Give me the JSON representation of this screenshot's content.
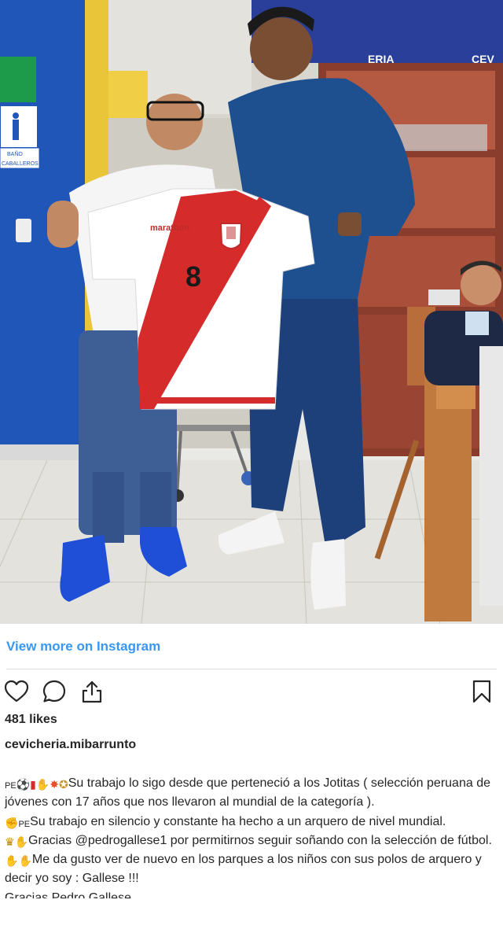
{
  "photo": {
    "store_sign_left": "BAÑO",
    "store_sign_right": "CABALLEROS",
    "wall_text_1": "ERIA",
    "wall_text_2": "CEV",
    "jersey_sponsor": "marathon",
    "jersey_number": "8"
  },
  "view_more": "View more on Instagram",
  "likes": "481 likes",
  "username": "cevicheria.mibarrunto",
  "caption": {
    "line1_prefix": "PE",
    "line1_text": "Su trabajo lo sigo desde que perteneció a los Jotitas ( selección peruana de jóvenes con 17 años que nos llevaron al mundial de la categoría ).",
    "line2_prefix": "PE",
    "line2_text": "Su trabajo en silencio y constante ha hecho a un arquero de nivel mundial.",
    "line3_before": "Gracias ",
    "line3_mention": "@pedrogallese1",
    "line3_after": " por permitirnos seguir soñando con la selección de fútbol.",
    "line4_text": "Me da gusto ver de nuevo en los parques a los niños con sus polos de arquero y decir yo soy : Gallese !!!",
    "line5_partial": "Gracias Pedro Gallese"
  },
  "icons": {
    "like": "heart-icon",
    "comment": "comment-icon",
    "share": "share-icon",
    "save": "bookmark-icon"
  },
  "colors": {
    "link": "#3897f0",
    "text": "#262626",
    "divider": "#dbdbdb"
  }
}
